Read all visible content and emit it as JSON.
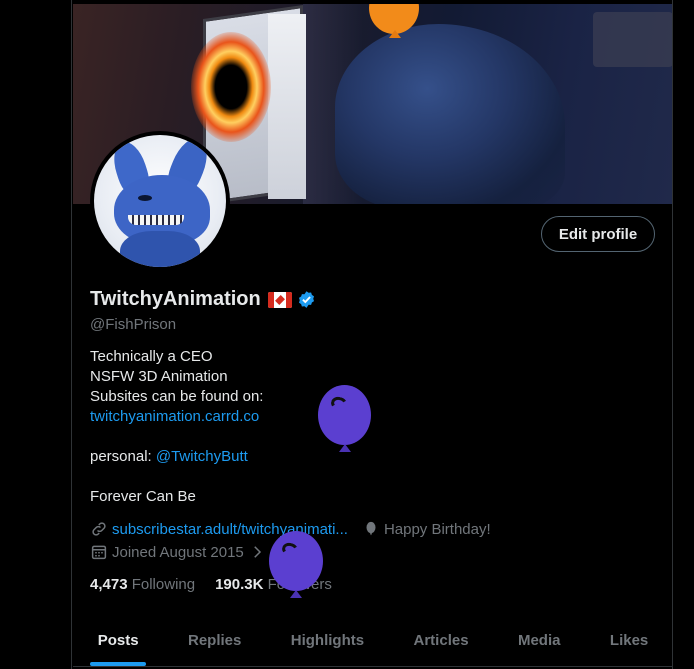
{
  "profile": {
    "display_name": "TwitchyAnimation",
    "handle": "@FishPrison",
    "edit_button": "Edit profile"
  },
  "bio": {
    "line1": "Technically a CEO",
    "line2": "NSFW 3D Animation",
    "line3": "Subsites can be found on:",
    "link1": "twitchyanimation.carrd.co",
    "personal_prefix": "personal: ",
    "personal_link": "@TwitchyButt",
    "line_last": "Forever Can Be"
  },
  "meta": {
    "website": "subscribestar.adult/twitchyanimati...",
    "birthday": "Happy Birthday!",
    "joined": "Joined August 2015"
  },
  "stats": {
    "following_count": "4,473",
    "following_label": "Following",
    "followers_count": "190.3K",
    "followers_label": "Followers"
  },
  "tabs": [
    {
      "label": "Posts"
    },
    {
      "label": "Replies"
    },
    {
      "label": "Highlights"
    },
    {
      "label": "Articles"
    },
    {
      "label": "Media"
    },
    {
      "label": "Likes"
    }
  ],
  "colors": {
    "accent": "#1d9bf0",
    "muted": "#71767b",
    "text": "#e7e9ea",
    "balloon_purple": "#5b3fd0",
    "balloon_orange": "#f28b1a"
  }
}
